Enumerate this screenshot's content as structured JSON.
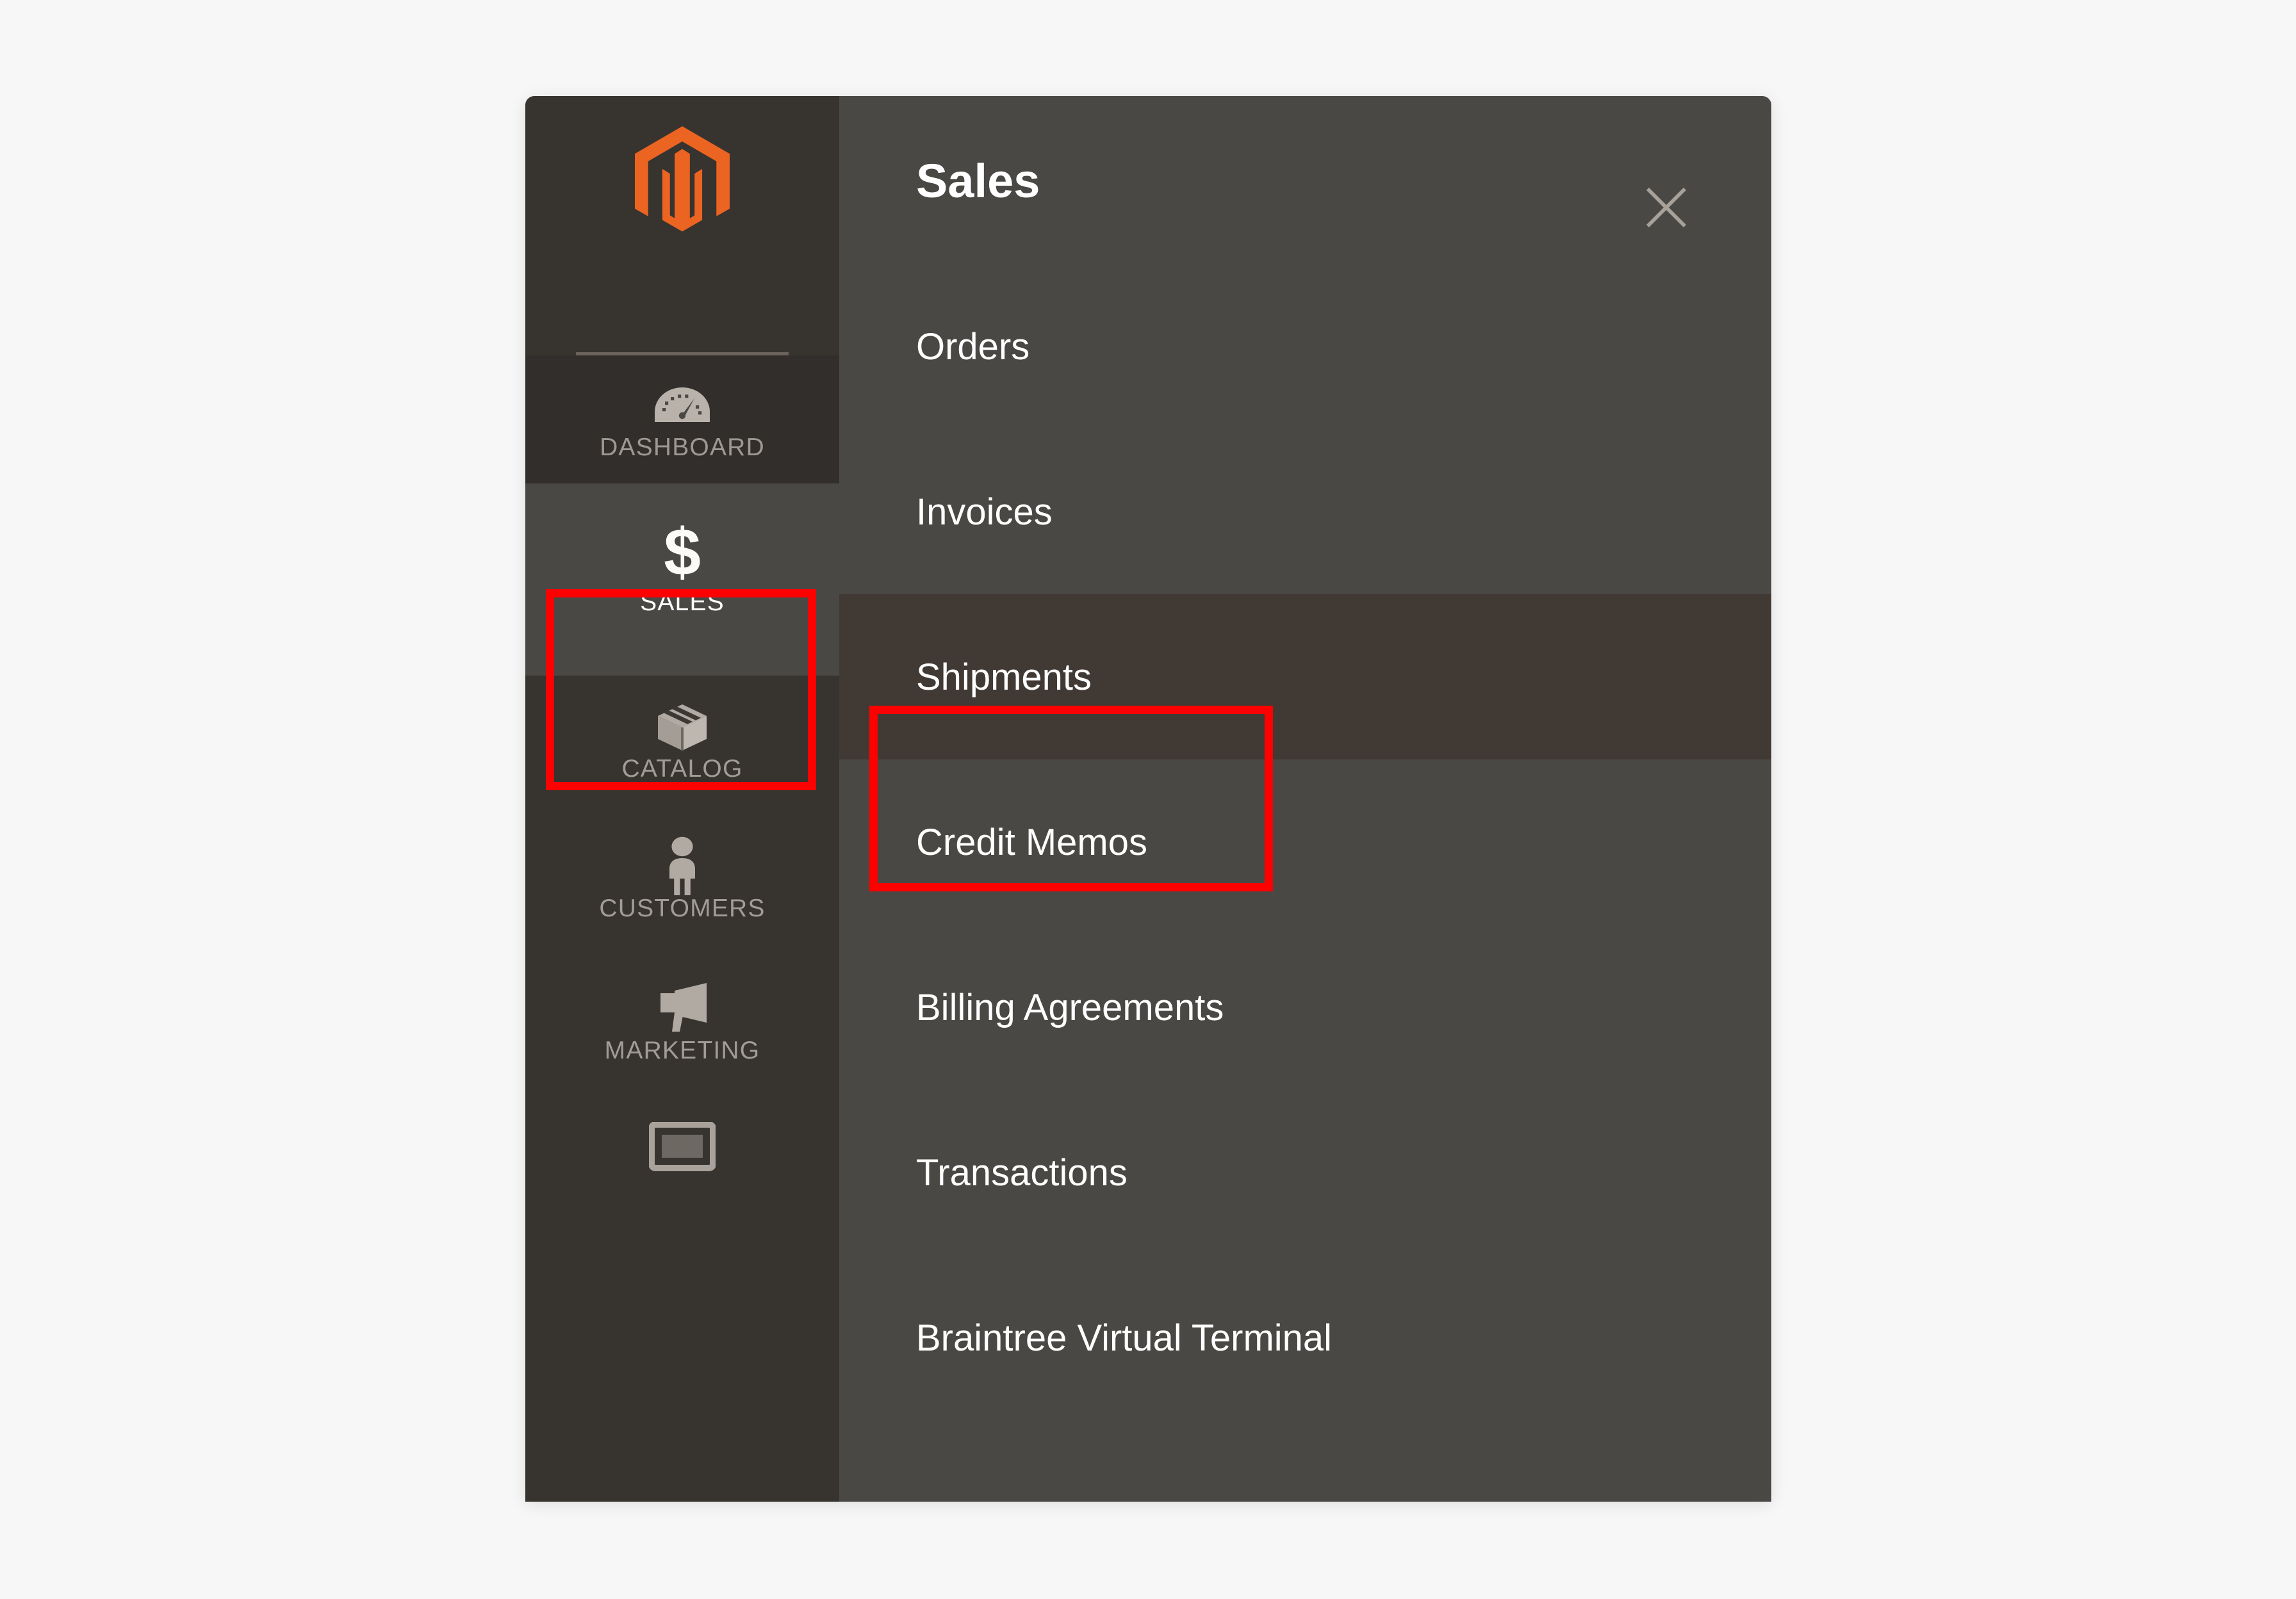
{
  "app": {
    "brand": "Magento",
    "accent_color": "#ec6421",
    "panel_bg": "#4a4844",
    "rail_bg": "#37332f",
    "hover_bg": "#413a34",
    "annotation_color": "#fd0000",
    "page_bg": "#f7f7f7"
  },
  "sidebar": {
    "logo_name": "magento-logo",
    "items": [
      {
        "label": "DASHBOARD",
        "icon": "speedometer-icon",
        "state": "default"
      },
      {
        "label": "SALES",
        "icon": "dollar-sign-icon",
        "state": "active"
      },
      {
        "label": "CATALOG",
        "icon": "box-icon",
        "state": "default"
      },
      {
        "label": "CUSTOMERS",
        "icon": "person-icon",
        "state": "default"
      },
      {
        "label": "MARKETING",
        "icon": "megaphone-icon",
        "state": "default"
      },
      {
        "label": "",
        "icon": "content-monitor-icon",
        "state": "clipped"
      }
    ]
  },
  "flyout": {
    "title": "Sales",
    "close_icon": "close-icon",
    "items": [
      {
        "label": "Orders",
        "hovered": false
      },
      {
        "label": "Invoices",
        "hovered": false
      },
      {
        "label": "Shipments",
        "hovered": true
      },
      {
        "label": "Credit Memos",
        "hovered": false
      },
      {
        "label": "Billing Agreements",
        "hovered": false
      },
      {
        "label": "Transactions",
        "hovered": false
      },
      {
        "label": "Braintree Virtual Terminal",
        "hovered": false
      }
    ]
  },
  "annotations": [
    {
      "target": "SALES",
      "shape": "rectangle",
      "color": "#fd0000"
    },
    {
      "target": "Shipments",
      "shape": "rectangle",
      "color": "#fd0000"
    }
  ]
}
